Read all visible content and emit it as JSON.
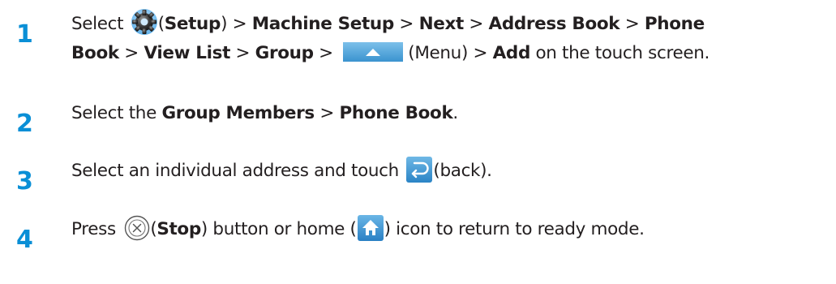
{
  "steps": [
    {
      "number": "1",
      "line1": {
        "t1": "Select ",
        "icon": "setup-gear-icon",
        "t2": "(",
        "b1": "Setup",
        "t3": ") > ",
        "b2": "Machine Setup",
        "t4": " > ",
        "b3": "Next",
        "t5": " > ",
        "b4": "Address Book",
        "t6": " > ",
        "b5": "Phone"
      },
      "line2": {
        "b1": "Book",
        "t1": " > ",
        "b2": "View List",
        "t2": " > ",
        "b3": "Group",
        "t3": " > ",
        "icon": "menu-up-arrow-icon",
        "t4": "(Menu) > ",
        "b4": "Add",
        "t5": " on the touch screen."
      }
    },
    {
      "number": "2",
      "t1": "Select the ",
      "b1": "Group Members",
      "t2": " > ",
      "b2": "Phone Book",
      "t3": "."
    },
    {
      "number": "3",
      "t1": "Select an individual address and touch ",
      "icon": "back-arrow-icon",
      "t2": "(back)."
    },
    {
      "number": "4",
      "t1": "Press ",
      "icon1": "stop-button-icon",
      "t2": "(",
      "b1": "Stop",
      "t3": ") button or home (",
      "icon2": "home-icon",
      "t4": ") icon to return to ready mode."
    }
  ],
  "colors": {
    "step_number": "#0a8fd6",
    "text": "#231f20",
    "menu_button": "#4aa3d8",
    "back_button": "#2f8fd0",
    "home_button": "#2e8bcf"
  }
}
